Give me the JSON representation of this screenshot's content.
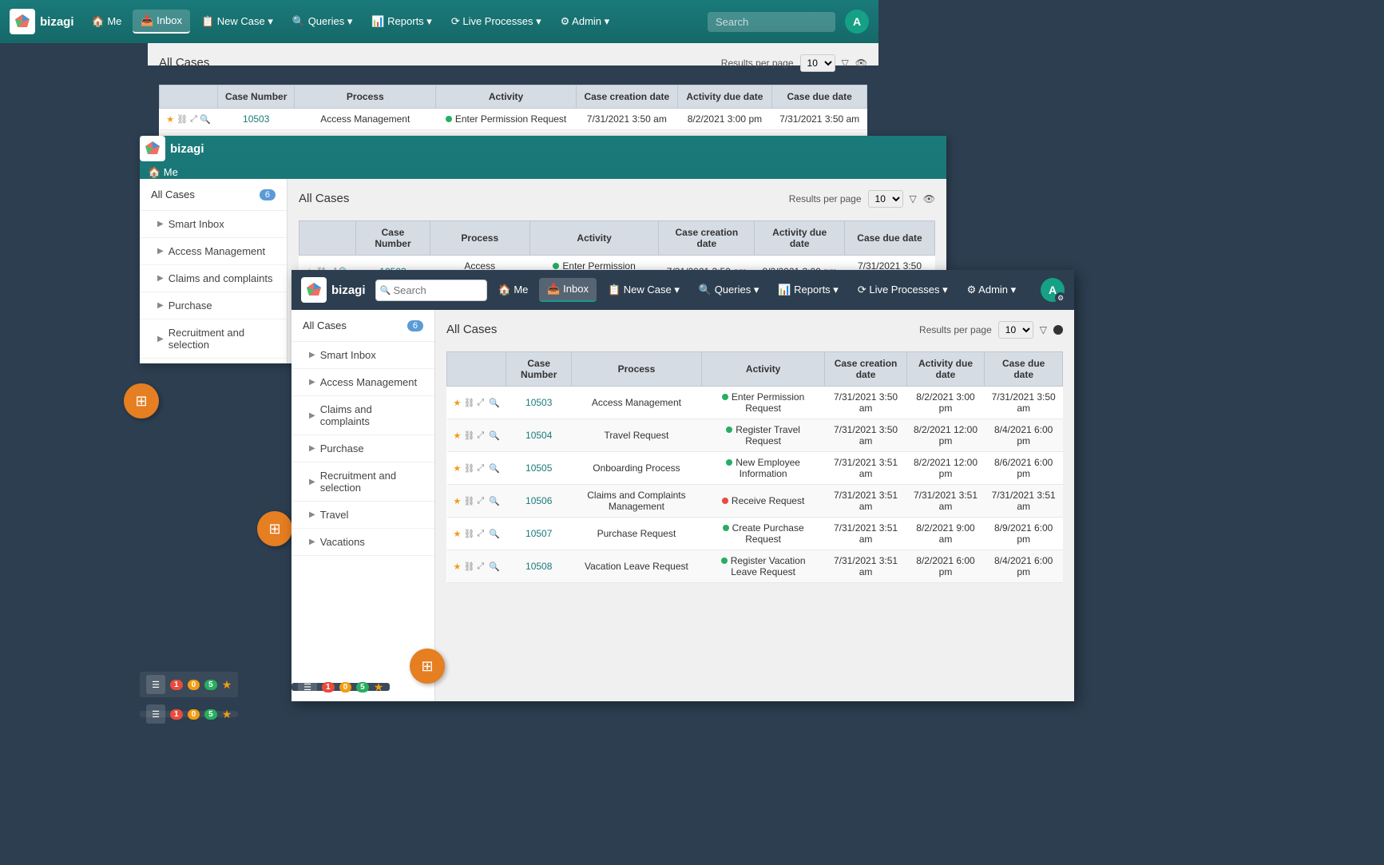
{
  "app": {
    "name": "bizagi",
    "logo_text": "b"
  },
  "nav": {
    "items": [
      {
        "label": "Me",
        "icon": "home"
      },
      {
        "label": "Inbox",
        "icon": "inbox",
        "active": true
      },
      {
        "label": "New Case",
        "icon": "new-case",
        "dropdown": true
      },
      {
        "label": "Queries",
        "icon": "queries",
        "dropdown": true
      },
      {
        "label": "Reports",
        "icon": "reports",
        "dropdown": true
      },
      {
        "label": "Live Processes",
        "icon": "live-processes",
        "dropdown": true
      },
      {
        "label": "Admin",
        "icon": "admin",
        "dropdown": true
      }
    ],
    "search_placeholder": "Search",
    "avatar_label": "A"
  },
  "sidebar": {
    "all_cases_label": "All Cases",
    "all_cases_count": 6,
    "items": [
      {
        "label": "Smart Inbox"
      },
      {
        "label": "Access Management"
      },
      {
        "label": "Claims and complaints"
      },
      {
        "label": "Purchase"
      },
      {
        "label": "Recruitment and selection"
      },
      {
        "label": "Travel"
      },
      {
        "label": "Vacations"
      }
    ]
  },
  "main": {
    "section_title": "All Cases",
    "results_per_page_label": "Results per page",
    "results_per_page_value": "10",
    "columns": [
      "Case Number",
      "Process",
      "Activity",
      "Case creation date",
      "Activity due date",
      "Case due date"
    ],
    "rows": [
      {
        "case_number": "10503",
        "process": "Access Management",
        "activity": "Enter Permission Request",
        "activity_dot": "green",
        "case_creation": "7/31/2021 3:50 am",
        "activity_due": "8/2/2021 3:00 pm",
        "case_due": "7/31/2021 3:50 am"
      },
      {
        "case_number": "10504",
        "process": "Travel Request",
        "activity": "Register Travel Request",
        "activity_dot": "green",
        "case_creation": "7/31/2021 3:50 am",
        "activity_due": "8/2/2021 12:00 pm",
        "case_due": "8/4/2021 6:00 pm"
      },
      {
        "case_number": "10505",
        "process": "Onboarding Process",
        "activity": "New Employee Information",
        "activity_dot": "green",
        "case_creation": "7/31/2021 3:51 am",
        "activity_due": "8/2/2021 12:00 pm",
        "case_due": "8/6/2021 6:00 pm"
      },
      {
        "case_number": "10506",
        "process": "Claims and Complaints Management",
        "activity": "Receive Request",
        "activity_dot": "red",
        "case_creation": "7/31/2021 3:51 am",
        "activity_due": "7/31/2021 3:51 am",
        "case_due": "7/31/2021 3:51 am"
      },
      {
        "case_number": "10507",
        "process": "Purchase Request",
        "activity": "Create Purchase Request",
        "activity_dot": "green",
        "case_creation": "7/31/2021 3:51 am",
        "activity_due": "8/2/2021 9:00 am",
        "case_due": "8/9/2021 6:00 pm"
      },
      {
        "case_number": "10508",
        "process": "Vacation Leave Request",
        "activity": "Register Vacation Leave Request",
        "activity_dot": "green",
        "case_creation": "7/31/2021 3:51 am",
        "activity_due": "8/2/2021 6:00 pm",
        "case_due": "8/4/2021 6:00 pm"
      }
    ]
  },
  "taskbar": {
    "items_label": "☰",
    "badge_red": "1",
    "badge_yellow": "0",
    "badge_green": "5",
    "star": "★"
  },
  "float_button_icon": "⊞",
  "layer3": {
    "nav_search_placeholder": "Search"
  }
}
